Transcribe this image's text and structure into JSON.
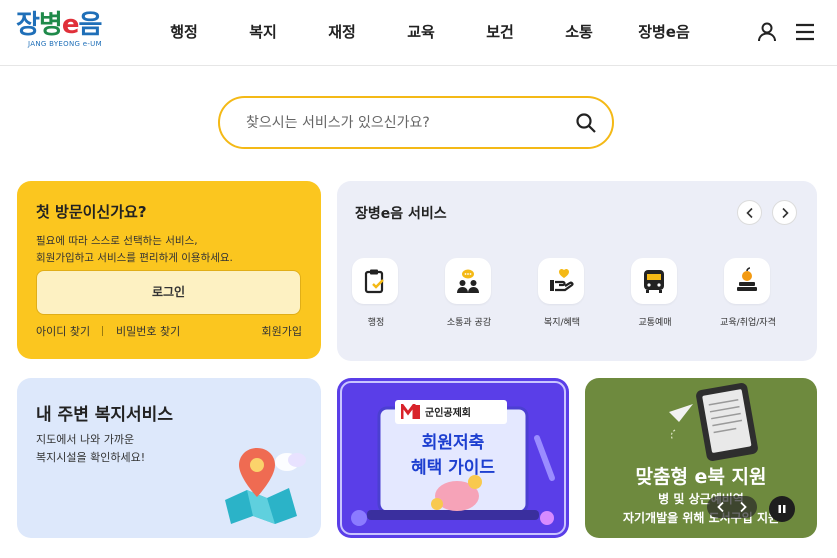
{
  "header": {
    "logo_text_1": "장",
    "logo_text_2": "병",
    "logo_text_3": "e",
    "logo_text_4": "음",
    "logo_sub": "JANG BYEONG e-UM",
    "nav": [
      "행정",
      "복지",
      "재정",
      "교육",
      "보건",
      "소통",
      "장병e음"
    ],
    "icons": [
      "user-icon",
      "hamburger-menu-icon"
    ]
  },
  "search": {
    "placeholder": "찾으시는 서비스가 있으신가요?",
    "value": "",
    "icon": "search-icon",
    "border_color": "#f4b916"
  },
  "first_visit": {
    "title": "첫 방문이신가요?",
    "desc_line1": "필요에 따라 스스로 선택하는 서비스,",
    "desc_line2": "회원가입하고 서비스를 편리하게 이용하세요.",
    "login_label": "로그인",
    "find_id": "아이디 찾기",
    "find_pw": "비밀번호 찾기",
    "join": "회원가입",
    "bg_color": "#fbc61f"
  },
  "services": {
    "title": "장병e음 서비스",
    "prev_icon": "chevron-left-icon",
    "next_icon": "chevron-right-icon",
    "items": [
      {
        "label": "행정",
        "icon": "clipboard-icon"
      },
      {
        "label": "소통과 공감",
        "icon": "chat-people-icon"
      },
      {
        "label": "복지/혜택",
        "icon": "heart-hand-icon"
      },
      {
        "label": "교통예매",
        "icon": "bus-icon"
      },
      {
        "label": "교육/취업/자격",
        "icon": "books-apple-icon"
      }
    ]
  },
  "welfare": {
    "title": "내 주변 복지서비스",
    "desc_line1": "지도에서 나와 가까운",
    "desc_line2": "복지시설을 확인하세요!",
    "icon": "map-pin-icon"
  },
  "banner1": {
    "badge": "군인공제회",
    "title_line1": "회원저축",
    "title_line2": "혜택 가이드"
  },
  "banner2": {
    "title": "맞춤형 e북 지원",
    "sub_line1": "병 및 상근예비역",
    "sub_line2": "자기개발을 위해 도서구입 지원",
    "controls": [
      "chevron-left-icon",
      "chevron-right-icon",
      "pause-icon"
    ]
  }
}
